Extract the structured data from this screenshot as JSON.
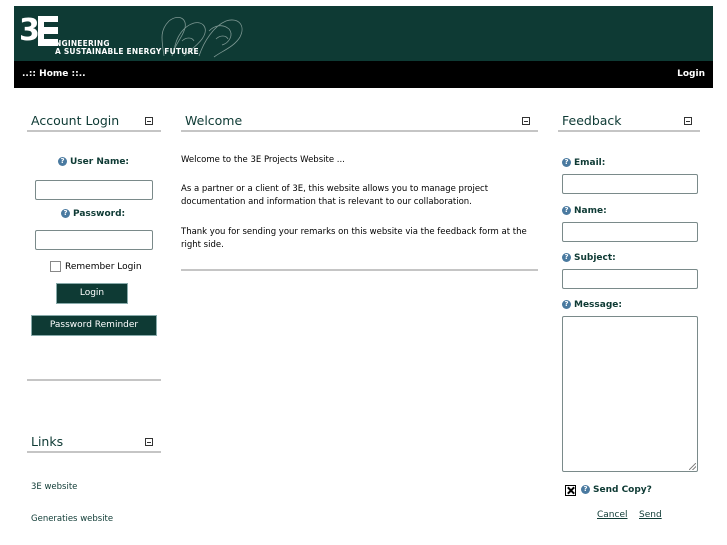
{
  "header": {
    "logo_line1": "NGINEERING",
    "logo_line2": "A SUSTAINABLE ENERGY FUTURE"
  },
  "navbar": {
    "home": "..:: Home ::..",
    "login": "Login"
  },
  "account_login": {
    "title": "Account Login",
    "username_label": "User Name:",
    "password_label": "Password:",
    "remember_label": "Remember Login",
    "login_button": "Login",
    "reminder_button": "Password Reminder"
  },
  "links": {
    "title": "Links",
    "items": [
      "3E website",
      "Generaties website"
    ]
  },
  "welcome": {
    "title": "Welcome",
    "para1": "Welcome to the 3E Projects Website ...",
    "para2": "As a partner or a client of 3E, this website allows you to manage project documentation and information that is relevant to our collaboration.",
    "para3": "Thank you for sending your remarks on this website via the feedback form at the right side."
  },
  "feedback": {
    "title": "Feedback",
    "email_label": "Email:",
    "name_label": "Name:",
    "subject_label": "Subject:",
    "message_label": "Message:",
    "send_copy_label": "Send Copy?",
    "cancel": "Cancel",
    "send": "Send"
  },
  "colors": {
    "brand": "#0e3a34",
    "nav": "#000000",
    "divider": "#c5c5c5"
  }
}
